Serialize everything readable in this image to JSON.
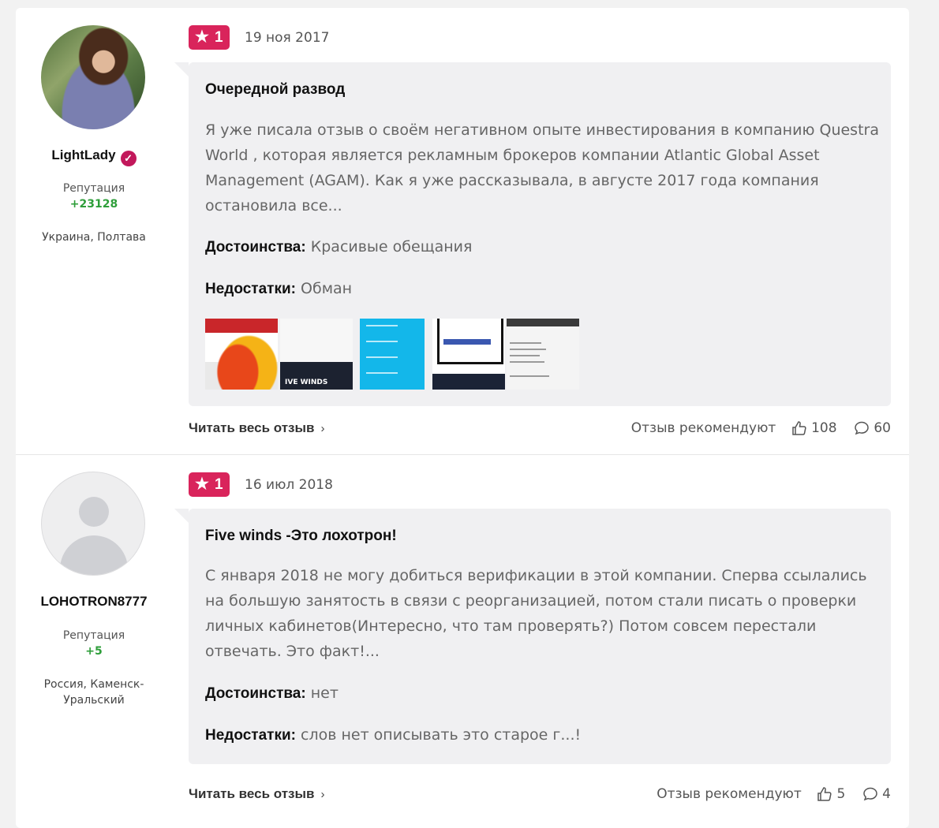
{
  "reviews": [
    {
      "user": {
        "name": "LightLady",
        "verified": true,
        "reputation_label": "Репутация",
        "reputation": "+23128",
        "location": "Украина, Полтава"
      },
      "rating": "1",
      "date": "19 ноя 2017",
      "title": "Очередной развод",
      "text": "Я уже писала отзыв о своём негативном опыте инвестирования в компанию Questra World , которая является рекламным брокеров компании Atlantic Global Asset Management (AGAM). Как я уже рассказывала, в августе 2017 года компания остановила все...",
      "pros_label": "Достоинства:",
      "pros": "Красивые обещания",
      "cons_label": "Недостатки:",
      "cons": "Обман",
      "thumb_caption": "IVE WINDS",
      "read_more": "Читать весь отзыв",
      "recommend_label": "Отзыв рекомендуют",
      "likes": "108",
      "comments": "60"
    },
    {
      "user": {
        "name": "LOHOTRON8777",
        "verified": false,
        "reputation_label": "Репутация",
        "reputation": "+5",
        "location": "Россия, Каменск-Уральский"
      },
      "rating": "1",
      "date": "16 июл 2018",
      "title": "Five winds -Это лохотрон!",
      "text": "С января 2018 не могу добиться верификации в этой компании. Сперва ссылались на большую занятость в связи с реорганизацией, потом стали писать о проверки личных кабинетов(Интересно, что там проверять?) Потом совсем перестали отвечать. Это факт!...",
      "pros_label": "Достоинства:",
      "pros": "нет",
      "cons_label": "Недостатки:",
      "cons": "слов нет описывать это старое г...!",
      "read_more": "Читать весь отзыв",
      "recommend_label": "Отзыв рекомендуют",
      "likes": "5",
      "comments": "4"
    }
  ],
  "icons": {
    "rating": "star-icon",
    "verified": "check-badge-icon",
    "likes": "thumbs-up-icon",
    "comments": "comment-icon",
    "chevron": "chevron-right-icon"
  },
  "colors": {
    "rating_badge": "#d9245b",
    "reputation": "#2e9e3a",
    "verified": "#c2185b"
  }
}
